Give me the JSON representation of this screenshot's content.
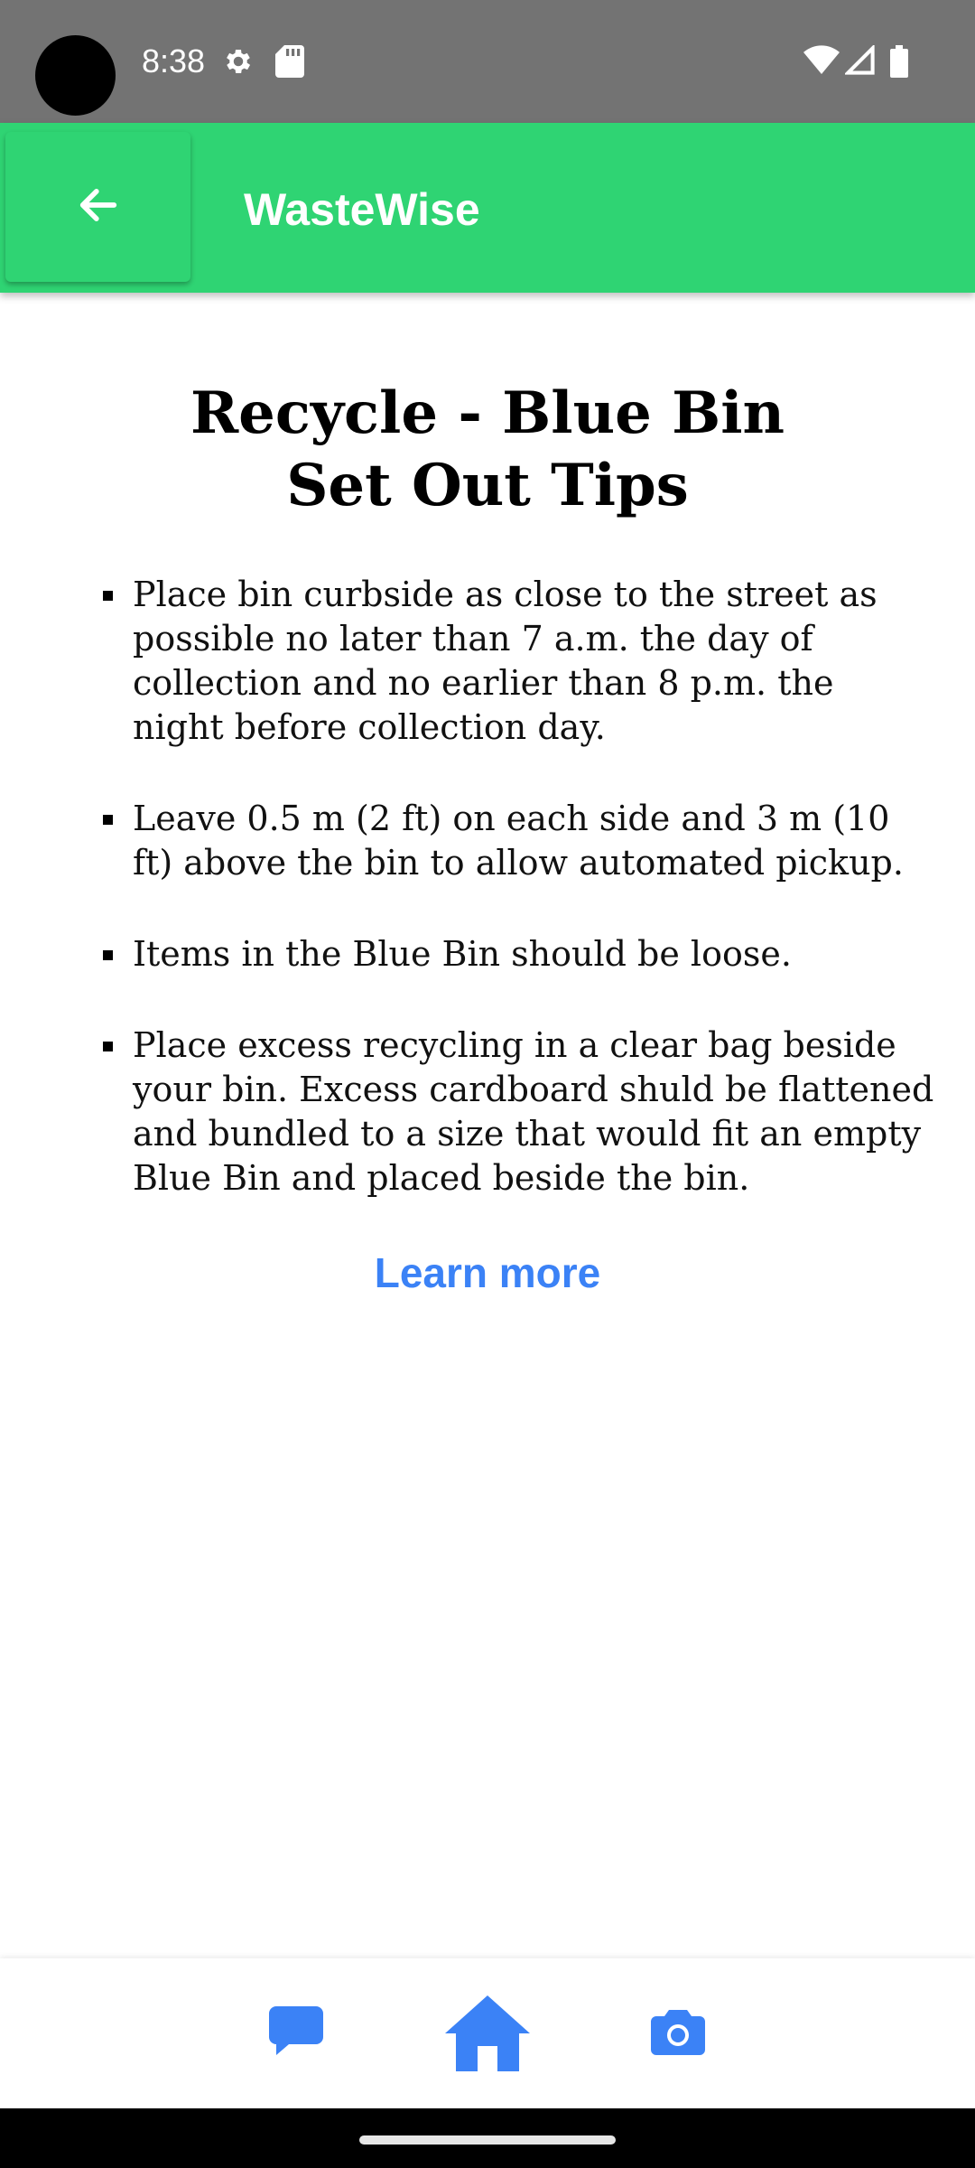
{
  "status_bar": {
    "time": "8:38",
    "icons": [
      "gear-icon",
      "sd-card-icon",
      "wifi-icon",
      "signal-icon",
      "battery-icon"
    ],
    "background": "#737373"
  },
  "app_bar": {
    "title": "WasteWise",
    "back_icon": "arrow-left-icon",
    "background": "#2fd473"
  },
  "main": {
    "title_line1": "Recycle - Blue Bin",
    "title_line2": "Set Out Tips",
    "tips": [
      "Place bin curbside as close to the street as possible no later than 7 a.m. the day of collection and no earlier than 8 p.m. the night before collection day.",
      "Leave 0.5 m (2 ft) on each side and 3 m (10 ft) above the bin to allow automated pickup.",
      "Items in the Blue Bin should be loose.",
      "Place excess recycling in a clear bag beside your bin. Excess cardboard shuld be flattened and bundled to a size that would fit an empty Blue Bin and placed beside the bin."
    ],
    "learn_more": "Learn more",
    "link_color": "#3b82f6"
  },
  "bottom_nav": {
    "items": [
      "chat-icon",
      "home-icon",
      "camera-icon"
    ],
    "accent": "#3b82f6"
  }
}
